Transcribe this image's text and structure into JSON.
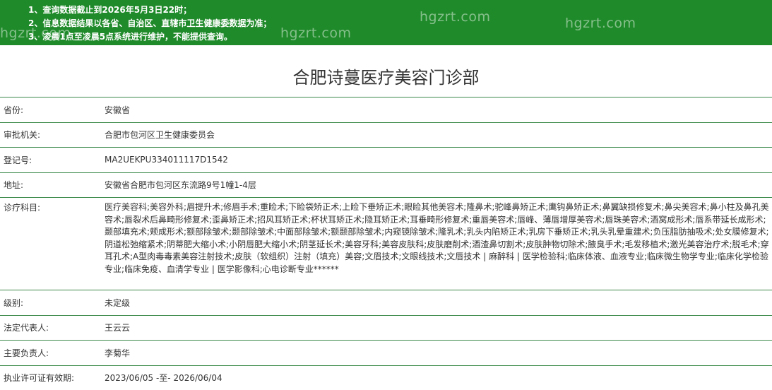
{
  "banner": {
    "notices": [
      "1、查询数据截止到2026年5月3日22时；",
      "2、信息数据结果以各省、自治区、直辖市卫生健康委数据为准；",
      "3、凌晨1点至凌晨5点系统进行维护，不能提供查询。"
    ],
    "watermark": "hgzrt.com",
    "background": "#1f8a2a"
  },
  "title": "合肥诗蔓医疗美容门诊部",
  "rows": [
    {
      "label": "省份:",
      "value": "安徽省"
    },
    {
      "label": "审批机关:",
      "value": "合肥市包河区卫生健康委员会"
    },
    {
      "label": "登记号:",
      "value": "MA2UEKPU334011117D1542"
    },
    {
      "label": "地址:",
      "value": "安徽省合肥市包河区东流路9号1幢1-4层"
    },
    {
      "label": "诊疗科目:",
      "value": "医疗美容科;美容外科;眉提升术;修眉手术;重睑术;下睑袋矫正术;上睑下垂矫正术;眼睑其他美容术;隆鼻术;驼峰鼻矫正术;鹰钩鼻矫正术;鼻翼缺损修复术;鼻尖美容术;鼻小柱及鼻孔美容术;唇裂术后鼻畸形修复术;歪鼻矫正术;招风耳矫正术;杯状耳矫正术;隐耳矫正术;耳垂畸形修复术;重唇美容术;唇峰、薄唇增厚美容术;唇珠美容术;酒窝成形术;唇系带延长成形术;颞部填充术;颊成形术;额部除皱术;颞部除皱术;中面部除皱术;额颞部除皱术;内窥镜除皱术;隆乳术;乳头内陷矫正术;乳房下垂矫正术;乳头乳晕重建术;负压脂肪抽吸术;处女膜修复术;阴道松弛缩紧术;阴蒂肥大缩小术;小阴唇肥大缩小术;阴茎延长术;美容牙科;美容皮肤科;皮肤磨削术;酒渣鼻切割术;皮肤肿物切除术;腋臭手术;毛发移植术;激光美容治疗术;脱毛术;穿耳孔术;A型肉毒毒素美容注射技术;皮肤（软组织）注射（填充）美容;文眉技术;文眼线技术;文唇技术 | 麻醉科 | 医学检验科;临床体液、血液专业;临床微生物学专业;临床化学检验专业;临床免疫、血清学专业 | 医学影像科;心电诊断专业******"
    },
    {
      "label": "级别:",
      "value": "未定级"
    },
    {
      "label": "法定代表人:",
      "value": "王云云"
    },
    {
      "label": "主要负责人:",
      "value": "李菊华"
    },
    {
      "label": "执业许可证有效期:",
      "value": "2023/06/05 -至- 2026/06/04"
    }
  ]
}
